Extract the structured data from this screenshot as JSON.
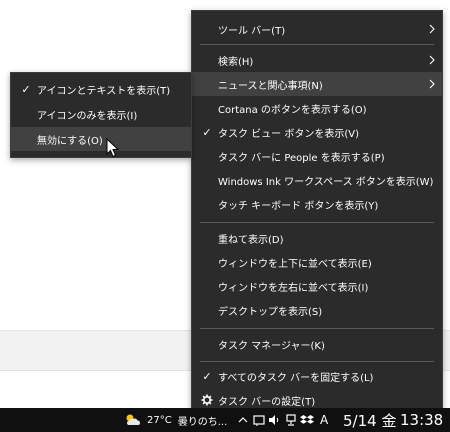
{
  "context_menu": {
    "items": [
      {
        "label": "ツール バー(T)",
        "checked": false,
        "submenu": true
      },
      {
        "label": "検索(H)",
        "checked": false,
        "submenu": true
      },
      {
        "label": "ニュースと関心事項(N)",
        "checked": false,
        "submenu": true,
        "highlighted": true
      },
      {
        "label": "Cortana のボタンを表示する(O)",
        "checked": false
      },
      {
        "label": "タスク ビュー ボタンを表示(V)",
        "checked": true
      },
      {
        "label": "タスク バーに People を表示する(P)",
        "checked": false
      },
      {
        "label": "Windows Ink ワークスペース ボタンを表示(W)",
        "checked": false
      },
      {
        "label": "タッチ キーボード ボタンを表示(Y)",
        "checked": false
      },
      {
        "label": "重ねて表示(D)",
        "checked": false
      },
      {
        "label": "ウィンドウを上下に並べて表示(E)",
        "checked": false
      },
      {
        "label": "ウィンドウを左右に並べて表示(I)",
        "checked": false
      },
      {
        "label": "デスクトップを表示(S)",
        "checked": false
      },
      {
        "label": "タスク マネージャー(K)",
        "checked": false
      },
      {
        "label": "すべてのタスク バーを固定する(L)",
        "checked": true
      },
      {
        "label": "タスク バーの設定(T)",
        "checked": false,
        "icon": "gear-icon"
      }
    ]
  },
  "submenu": {
    "items": [
      {
        "label": "アイコンとテキストを表示(T)",
        "checked": true
      },
      {
        "label": "アイコンのみを表示(I)",
        "checked": false
      },
      {
        "label": "無効にする(O)",
        "checked": false,
        "highlighted": true
      }
    ]
  },
  "taskbar": {
    "weather_temp": "27°C",
    "weather_text": "曇りのち...",
    "date": "5/14 金",
    "time": "13:38",
    "ime": "A"
  },
  "colors": {
    "menu_bg": "#2b2b2b",
    "menu_highlight": "#414141",
    "separator": "#5a5a5a",
    "taskbar": "#101010"
  }
}
